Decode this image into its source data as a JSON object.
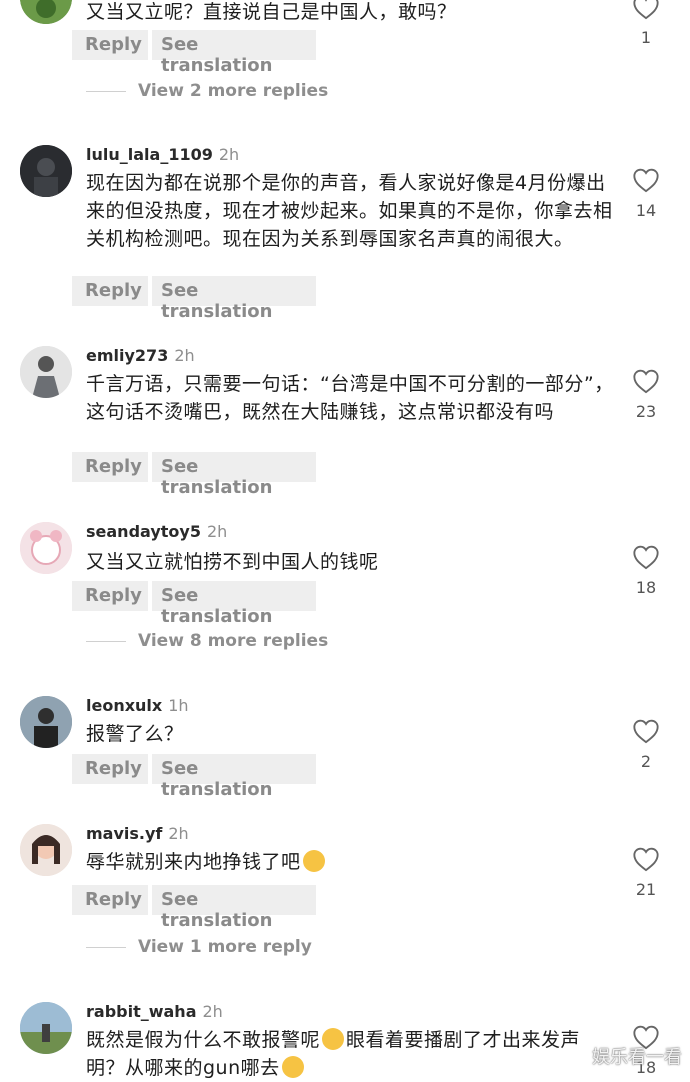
{
  "comments": [
    {
      "user": "",
      "time": "",
      "text": "又当又立呢？直接说自己是中国人，敢吗？",
      "likes": "1",
      "reply": "Reply",
      "translate": "See translation",
      "more_replies": "View 2 more replies"
    },
    {
      "user": "lulu_lala_1109",
      "time": "2h",
      "text": "现在因为都在说那个是你的声音，看人家说好像是4月份爆出来的但没热度，现在才被炒起来。如果真的不是你，你拿去相关机构检测吧。现在因为关系到辱国家名声真的闹很大。",
      "likes": "14",
      "reply": "Reply",
      "translate": "See translation"
    },
    {
      "user": "emliy273",
      "time": "2h",
      "text": "千言万语，只需要一句话：“台湾是中国不可分割的一部分”，这句话不烫嘴巴，既然在大陆赚钱，这点常识都没有吗",
      "likes": "23",
      "reply": "Reply",
      "translate": "See translation"
    },
    {
      "user": "seandaytoy5",
      "time": "2h",
      "text": "又当又立就怕捞不到中国人的钱呢",
      "likes": "18",
      "reply": "Reply",
      "translate": "See translation",
      "more_replies": "View 8 more replies"
    },
    {
      "user": "leonxulx",
      "time": "1h",
      "text": "报警了么？",
      "likes": "2",
      "reply": "Reply",
      "translate": "See translation"
    },
    {
      "user": "mavis.yf",
      "time": "2h",
      "text": "辱华就别来内地挣钱了吧",
      "likes": "21",
      "reply": "Reply",
      "translate": "See translation",
      "more_replies": "View 1 more reply"
    },
    {
      "user": "rabbit_waha",
      "time": "2h",
      "text_a": "既然是假为什么不敢报警呢",
      "text_b": "眼看着要播剧了才出来发声明？从哪来的gun哪去",
      "likes": "18"
    }
  ],
  "watermark": "娱乐看一看"
}
